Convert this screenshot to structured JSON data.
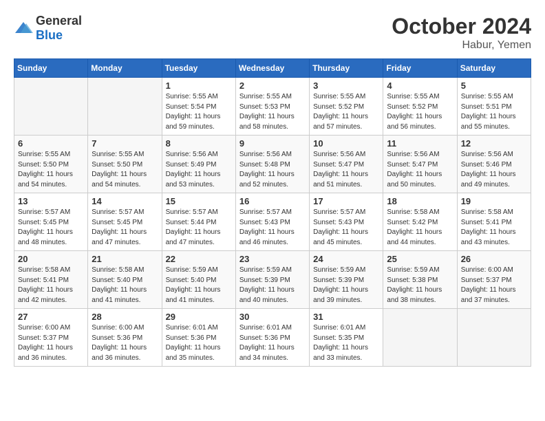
{
  "header": {
    "logo_general": "General",
    "logo_blue": "Blue",
    "month_year": "October 2024",
    "location": "Habur, Yemen"
  },
  "weekdays": [
    "Sunday",
    "Monday",
    "Tuesday",
    "Wednesday",
    "Thursday",
    "Friday",
    "Saturday"
  ],
  "weeks": [
    [
      {
        "day": "",
        "info": ""
      },
      {
        "day": "",
        "info": ""
      },
      {
        "day": "1",
        "info": "Sunrise: 5:55 AM\nSunset: 5:54 PM\nDaylight: 11 hours and 59 minutes."
      },
      {
        "day": "2",
        "info": "Sunrise: 5:55 AM\nSunset: 5:53 PM\nDaylight: 11 hours and 58 minutes."
      },
      {
        "day": "3",
        "info": "Sunrise: 5:55 AM\nSunset: 5:52 PM\nDaylight: 11 hours and 57 minutes."
      },
      {
        "day": "4",
        "info": "Sunrise: 5:55 AM\nSunset: 5:52 PM\nDaylight: 11 hours and 56 minutes."
      },
      {
        "day": "5",
        "info": "Sunrise: 5:55 AM\nSunset: 5:51 PM\nDaylight: 11 hours and 55 minutes."
      }
    ],
    [
      {
        "day": "6",
        "info": "Sunrise: 5:55 AM\nSunset: 5:50 PM\nDaylight: 11 hours and 54 minutes."
      },
      {
        "day": "7",
        "info": "Sunrise: 5:55 AM\nSunset: 5:50 PM\nDaylight: 11 hours and 54 minutes."
      },
      {
        "day": "8",
        "info": "Sunrise: 5:56 AM\nSunset: 5:49 PM\nDaylight: 11 hours and 53 minutes."
      },
      {
        "day": "9",
        "info": "Sunrise: 5:56 AM\nSunset: 5:48 PM\nDaylight: 11 hours and 52 minutes."
      },
      {
        "day": "10",
        "info": "Sunrise: 5:56 AM\nSunset: 5:47 PM\nDaylight: 11 hours and 51 minutes."
      },
      {
        "day": "11",
        "info": "Sunrise: 5:56 AM\nSunset: 5:47 PM\nDaylight: 11 hours and 50 minutes."
      },
      {
        "day": "12",
        "info": "Sunrise: 5:56 AM\nSunset: 5:46 PM\nDaylight: 11 hours and 49 minutes."
      }
    ],
    [
      {
        "day": "13",
        "info": "Sunrise: 5:57 AM\nSunset: 5:45 PM\nDaylight: 11 hours and 48 minutes."
      },
      {
        "day": "14",
        "info": "Sunrise: 5:57 AM\nSunset: 5:45 PM\nDaylight: 11 hours and 47 minutes."
      },
      {
        "day": "15",
        "info": "Sunrise: 5:57 AM\nSunset: 5:44 PM\nDaylight: 11 hours and 47 minutes."
      },
      {
        "day": "16",
        "info": "Sunrise: 5:57 AM\nSunset: 5:43 PM\nDaylight: 11 hours and 46 minutes."
      },
      {
        "day": "17",
        "info": "Sunrise: 5:57 AM\nSunset: 5:43 PM\nDaylight: 11 hours and 45 minutes."
      },
      {
        "day": "18",
        "info": "Sunrise: 5:58 AM\nSunset: 5:42 PM\nDaylight: 11 hours and 44 minutes."
      },
      {
        "day": "19",
        "info": "Sunrise: 5:58 AM\nSunset: 5:41 PM\nDaylight: 11 hours and 43 minutes."
      }
    ],
    [
      {
        "day": "20",
        "info": "Sunrise: 5:58 AM\nSunset: 5:41 PM\nDaylight: 11 hours and 42 minutes."
      },
      {
        "day": "21",
        "info": "Sunrise: 5:58 AM\nSunset: 5:40 PM\nDaylight: 11 hours and 41 minutes."
      },
      {
        "day": "22",
        "info": "Sunrise: 5:59 AM\nSunset: 5:40 PM\nDaylight: 11 hours and 41 minutes."
      },
      {
        "day": "23",
        "info": "Sunrise: 5:59 AM\nSunset: 5:39 PM\nDaylight: 11 hours and 40 minutes."
      },
      {
        "day": "24",
        "info": "Sunrise: 5:59 AM\nSunset: 5:39 PM\nDaylight: 11 hours and 39 minutes."
      },
      {
        "day": "25",
        "info": "Sunrise: 5:59 AM\nSunset: 5:38 PM\nDaylight: 11 hours and 38 minutes."
      },
      {
        "day": "26",
        "info": "Sunrise: 6:00 AM\nSunset: 5:37 PM\nDaylight: 11 hours and 37 minutes."
      }
    ],
    [
      {
        "day": "27",
        "info": "Sunrise: 6:00 AM\nSunset: 5:37 PM\nDaylight: 11 hours and 36 minutes."
      },
      {
        "day": "28",
        "info": "Sunrise: 6:00 AM\nSunset: 5:36 PM\nDaylight: 11 hours and 36 minutes."
      },
      {
        "day": "29",
        "info": "Sunrise: 6:01 AM\nSunset: 5:36 PM\nDaylight: 11 hours and 35 minutes."
      },
      {
        "day": "30",
        "info": "Sunrise: 6:01 AM\nSunset: 5:36 PM\nDaylight: 11 hours and 34 minutes."
      },
      {
        "day": "31",
        "info": "Sunrise: 6:01 AM\nSunset: 5:35 PM\nDaylight: 11 hours and 33 minutes."
      },
      {
        "day": "",
        "info": ""
      },
      {
        "day": "",
        "info": ""
      }
    ]
  ]
}
